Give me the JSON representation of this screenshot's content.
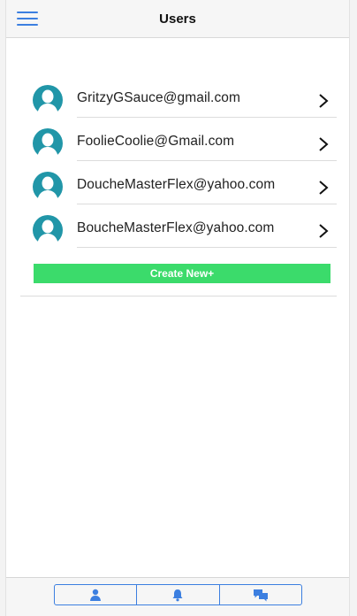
{
  "header": {
    "title": "Users",
    "menu_icon": "hamburger-menu-icon"
  },
  "users": [
    {
      "email": "GritzyGSauce@gmail.com"
    },
    {
      "email": "FoolieCoolie@Gmail.com"
    },
    {
      "email": "DoucheMasterFlex@yahoo.com"
    },
    {
      "email": "BoucheMasterFlex@yahoo.com"
    }
  ],
  "create_button": {
    "label": "Create New+"
  },
  "tabs": [
    {
      "icon": "user-icon"
    },
    {
      "icon": "bell-icon"
    },
    {
      "icon": "chat-icon"
    }
  ],
  "colors": {
    "accent": "#3c7fe0",
    "avatar": "#2196a8",
    "create_button": "#3bdb6b"
  }
}
